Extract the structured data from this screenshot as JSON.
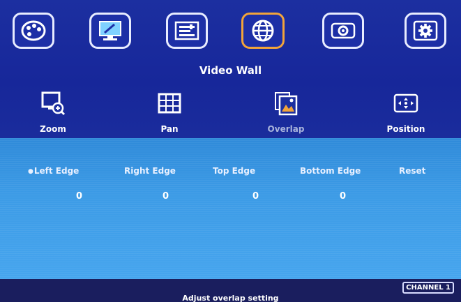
{
  "top_menu": {
    "icons": [
      {
        "name": "palette-icon",
        "active": false
      },
      {
        "name": "pc-settings-icon",
        "active": false
      },
      {
        "name": "adjust-bars-icon",
        "active": false
      },
      {
        "name": "globe-icon",
        "active": true
      },
      {
        "name": "projector-icon",
        "active": false
      },
      {
        "name": "gear-icon",
        "active": false
      }
    ],
    "title": "Video Wall"
  },
  "submenu": {
    "items": [
      {
        "label": "Zoom",
        "icon": "zoom-icon"
      },
      {
        "label": "Pan",
        "icon": "grid-icon"
      },
      {
        "label": "Overlap",
        "icon": "overlap-icon",
        "active": true
      },
      {
        "label": "Position",
        "icon": "position-arrows-icon"
      }
    ]
  },
  "overlap": {
    "left_label": "Left Edge",
    "right_label": "Right Edge",
    "top_label": "Top Edge",
    "bottom_label": "Bottom Edge",
    "reset_label": "Reset",
    "left_value": "0",
    "right_value": "0",
    "top_value": "0",
    "bottom_value": "0"
  },
  "status": {
    "text": "Adjust overlap setting",
    "channel": "CHANNEL 1"
  },
  "colors": {
    "background": "#1a2c95",
    "active_border": "#f2a43a",
    "panel": "#3c9be6",
    "bottom_bar": "#1a1e5e"
  }
}
